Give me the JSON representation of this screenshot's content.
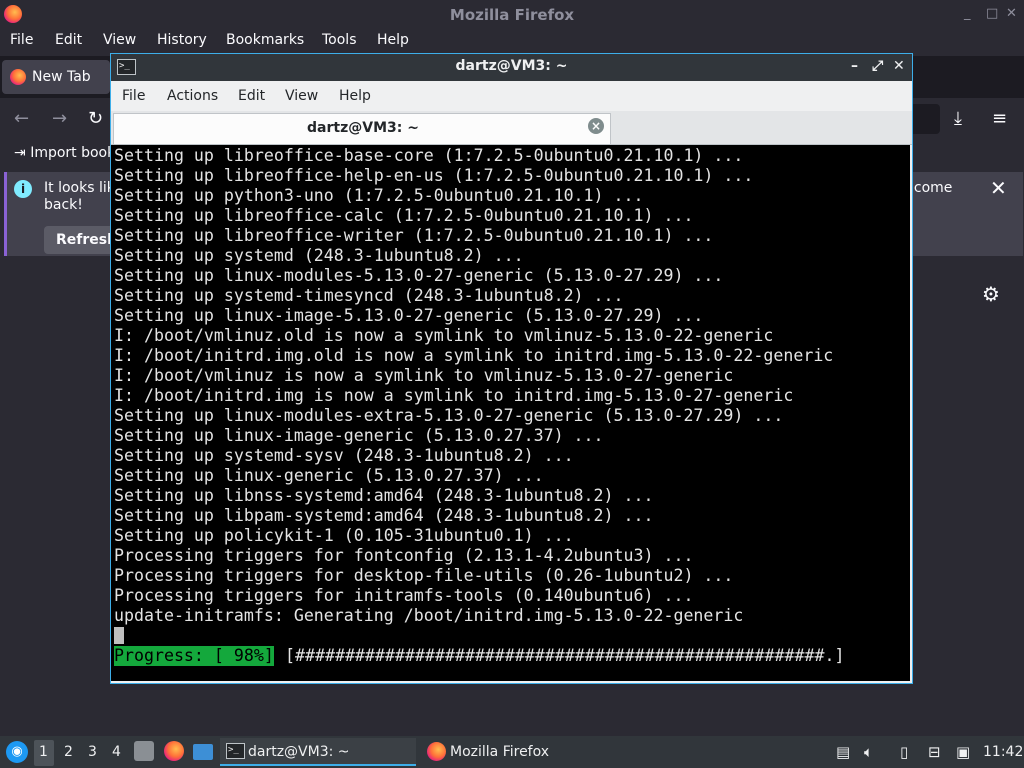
{
  "firefox": {
    "title": "Mozilla Firefox",
    "window_controls": [
      "_",
      "□",
      "✕"
    ],
    "menu": [
      "File",
      "Edit",
      "View",
      "History",
      "Bookmarks",
      "Tools",
      "Help"
    ],
    "tab_label": "New Tab",
    "import_label": "Import book",
    "notice_text_line1": "It looks lik",
    "notice_text_line2": "back!",
    "notice_text_right": "lcome",
    "refresh_label": "Refresh"
  },
  "terminal": {
    "title": "dartz@VM3: ~",
    "menu": [
      "File",
      "Actions",
      "Edit",
      "View",
      "Help"
    ],
    "tab_label": "dartz@VM3: ~",
    "lines": [
      "Setting up libreoffice-base-core (1:7.2.5-0ubuntu0.21.10.1) ...",
      "Setting up libreoffice-help-en-us (1:7.2.5-0ubuntu0.21.10.1) ...",
      "Setting up python3-uno (1:7.2.5-0ubuntu0.21.10.1) ...",
      "Setting up libreoffice-calc (1:7.2.5-0ubuntu0.21.10.1) ...",
      "Setting up libreoffice-writer (1:7.2.5-0ubuntu0.21.10.1) ...",
      "Setting up systemd (248.3-1ubuntu8.2) ...",
      "Setting up linux-modules-5.13.0-27-generic (5.13.0-27.29) ...",
      "Setting up systemd-timesyncd (248.3-1ubuntu8.2) ...",
      "Setting up linux-image-5.13.0-27-generic (5.13.0-27.29) ...",
      "I: /boot/vmlinuz.old is now a symlink to vmlinuz-5.13.0-22-generic",
      "I: /boot/initrd.img.old is now a symlink to initrd.img-5.13.0-22-generic",
      "I: /boot/vmlinuz is now a symlink to vmlinuz-5.13.0-27-generic",
      "I: /boot/initrd.img is now a symlink to initrd.img-5.13.0-27-generic",
      "Setting up linux-modules-extra-5.13.0-27-generic (5.13.0-27.29) ...",
      "Setting up linux-image-generic (5.13.0.27.37) ...",
      "Setting up systemd-sysv (248.3-1ubuntu8.2) ...",
      "Setting up linux-generic (5.13.0.27.37) ...",
      "Setting up libnss-systemd:amd64 (248.3-1ubuntu8.2) ...",
      "Setting up libpam-systemd:amd64 (248.3-1ubuntu8.2) ...",
      "Setting up policykit-1 (0.105-31ubuntu0.1) ...",
      "Processing triggers for fontconfig (2.13.1-4.2ubuntu3) ...",
      "Processing triggers for desktop-file-utils (0.26-1ubuntu2) ...",
      "Processing triggers for initramfs-tools (0.140ubuntu6) ...",
      "update-initramfs: Generating /boot/initrd.img-5.13.0-22-generic"
    ],
    "progress_label": "Progress: [ 98%]",
    "progress_bar": "[#####################################################.]",
    "progress_fraction": 0.98
  },
  "taskbar": {
    "workspaces": [
      "1",
      "2",
      "3",
      "4"
    ],
    "active_workspace": "1",
    "task_terminal": "dartz@VM3: ~",
    "task_firefox": "Mozilla Firefox",
    "clock": "11:42"
  },
  "colors": {
    "terminal_bg": "#000000",
    "terminal_fg": "#e4e4e4",
    "progress_green": "#14a83c",
    "accent_blue": "#3daee9",
    "firefox_dark": "#2b2a33"
  },
  "icons": {
    "firefox": "firefox-logo-icon",
    "terminal": "terminal-icon",
    "info": "info-icon",
    "gear": "gear-icon",
    "start": "start-menu-icon"
  }
}
